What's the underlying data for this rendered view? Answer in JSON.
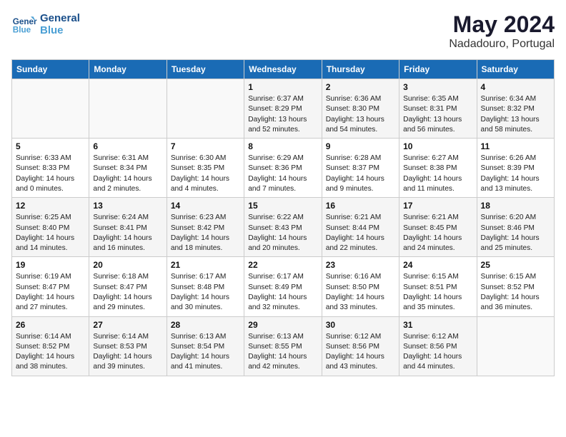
{
  "logo": {
    "line1": "General",
    "line2": "Blue"
  },
  "title": "May 2024",
  "location": "Nadadouro, Portugal",
  "days_of_week": [
    "Sunday",
    "Monday",
    "Tuesday",
    "Wednesday",
    "Thursday",
    "Friday",
    "Saturday"
  ],
  "weeks": [
    [
      {
        "day": "",
        "text": ""
      },
      {
        "day": "",
        "text": ""
      },
      {
        "day": "",
        "text": ""
      },
      {
        "day": "1",
        "text": "Sunrise: 6:37 AM\nSunset: 8:29 PM\nDaylight: 13 hours\nand 52 minutes."
      },
      {
        "day": "2",
        "text": "Sunrise: 6:36 AM\nSunset: 8:30 PM\nDaylight: 13 hours\nand 54 minutes."
      },
      {
        "day": "3",
        "text": "Sunrise: 6:35 AM\nSunset: 8:31 PM\nDaylight: 13 hours\nand 56 minutes."
      },
      {
        "day": "4",
        "text": "Sunrise: 6:34 AM\nSunset: 8:32 PM\nDaylight: 13 hours\nand 58 minutes."
      }
    ],
    [
      {
        "day": "5",
        "text": "Sunrise: 6:33 AM\nSunset: 8:33 PM\nDaylight: 14 hours\nand 0 minutes."
      },
      {
        "day": "6",
        "text": "Sunrise: 6:31 AM\nSunset: 8:34 PM\nDaylight: 14 hours\nand 2 minutes."
      },
      {
        "day": "7",
        "text": "Sunrise: 6:30 AM\nSunset: 8:35 PM\nDaylight: 14 hours\nand 4 minutes."
      },
      {
        "day": "8",
        "text": "Sunrise: 6:29 AM\nSunset: 8:36 PM\nDaylight: 14 hours\nand 7 minutes."
      },
      {
        "day": "9",
        "text": "Sunrise: 6:28 AM\nSunset: 8:37 PM\nDaylight: 14 hours\nand 9 minutes."
      },
      {
        "day": "10",
        "text": "Sunrise: 6:27 AM\nSunset: 8:38 PM\nDaylight: 14 hours\nand 11 minutes."
      },
      {
        "day": "11",
        "text": "Sunrise: 6:26 AM\nSunset: 8:39 PM\nDaylight: 14 hours\nand 13 minutes."
      }
    ],
    [
      {
        "day": "12",
        "text": "Sunrise: 6:25 AM\nSunset: 8:40 PM\nDaylight: 14 hours\nand 14 minutes."
      },
      {
        "day": "13",
        "text": "Sunrise: 6:24 AM\nSunset: 8:41 PM\nDaylight: 14 hours\nand 16 minutes."
      },
      {
        "day": "14",
        "text": "Sunrise: 6:23 AM\nSunset: 8:42 PM\nDaylight: 14 hours\nand 18 minutes."
      },
      {
        "day": "15",
        "text": "Sunrise: 6:22 AM\nSunset: 8:43 PM\nDaylight: 14 hours\nand 20 minutes."
      },
      {
        "day": "16",
        "text": "Sunrise: 6:21 AM\nSunset: 8:44 PM\nDaylight: 14 hours\nand 22 minutes."
      },
      {
        "day": "17",
        "text": "Sunrise: 6:21 AM\nSunset: 8:45 PM\nDaylight: 14 hours\nand 24 minutes."
      },
      {
        "day": "18",
        "text": "Sunrise: 6:20 AM\nSunset: 8:46 PM\nDaylight: 14 hours\nand 25 minutes."
      }
    ],
    [
      {
        "day": "19",
        "text": "Sunrise: 6:19 AM\nSunset: 8:47 PM\nDaylight: 14 hours\nand 27 minutes."
      },
      {
        "day": "20",
        "text": "Sunrise: 6:18 AM\nSunset: 8:47 PM\nDaylight: 14 hours\nand 29 minutes."
      },
      {
        "day": "21",
        "text": "Sunrise: 6:17 AM\nSunset: 8:48 PM\nDaylight: 14 hours\nand 30 minutes."
      },
      {
        "day": "22",
        "text": "Sunrise: 6:17 AM\nSunset: 8:49 PM\nDaylight: 14 hours\nand 32 minutes."
      },
      {
        "day": "23",
        "text": "Sunrise: 6:16 AM\nSunset: 8:50 PM\nDaylight: 14 hours\nand 33 minutes."
      },
      {
        "day": "24",
        "text": "Sunrise: 6:15 AM\nSunset: 8:51 PM\nDaylight: 14 hours\nand 35 minutes."
      },
      {
        "day": "25",
        "text": "Sunrise: 6:15 AM\nSunset: 8:52 PM\nDaylight: 14 hours\nand 36 minutes."
      }
    ],
    [
      {
        "day": "26",
        "text": "Sunrise: 6:14 AM\nSunset: 8:52 PM\nDaylight: 14 hours\nand 38 minutes."
      },
      {
        "day": "27",
        "text": "Sunrise: 6:14 AM\nSunset: 8:53 PM\nDaylight: 14 hours\nand 39 minutes."
      },
      {
        "day": "28",
        "text": "Sunrise: 6:13 AM\nSunset: 8:54 PM\nDaylight: 14 hours\nand 41 minutes."
      },
      {
        "day": "29",
        "text": "Sunrise: 6:13 AM\nSunset: 8:55 PM\nDaylight: 14 hours\nand 42 minutes."
      },
      {
        "day": "30",
        "text": "Sunrise: 6:12 AM\nSunset: 8:56 PM\nDaylight: 14 hours\nand 43 minutes."
      },
      {
        "day": "31",
        "text": "Sunrise: 6:12 AM\nSunset: 8:56 PM\nDaylight: 14 hours\nand 44 minutes."
      },
      {
        "day": "",
        "text": ""
      }
    ]
  ]
}
